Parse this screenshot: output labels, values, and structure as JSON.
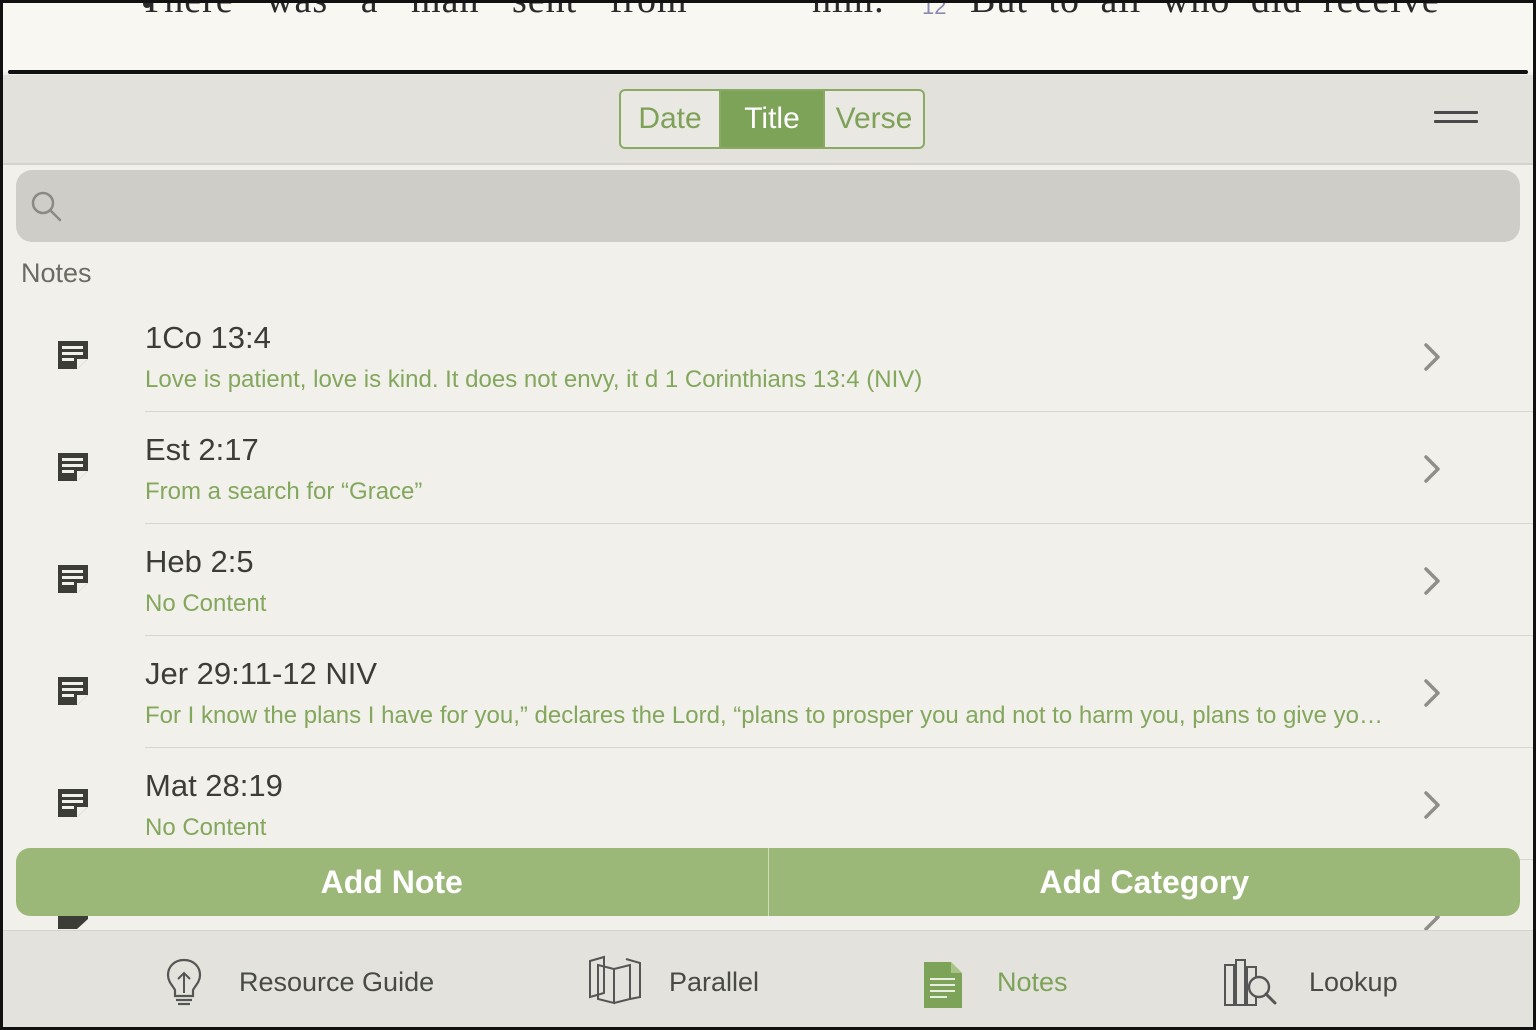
{
  "bible_text": {
    "left_line": "There was a man sent from",
    "right_line_a": "him.",
    "verse_number": "12",
    "right_line_b": "But to all who did receive"
  },
  "header": {
    "sort_options": [
      {
        "label": "Date",
        "selected": false
      },
      {
        "label": "Title",
        "selected": true
      },
      {
        "label": "Verse",
        "selected": false
      }
    ],
    "menu_icon": "hamburger-menu-icon"
  },
  "search": {
    "placeholder": "",
    "value": ""
  },
  "section": {
    "label": "Notes"
  },
  "notes": [
    {
      "title": "1Co 13:4",
      "subtitle": "Love is patient, love is kind. It does not envy, it d 1 Corinthians 13:4 (NIV)"
    },
    {
      "title": "Est 2:17",
      "subtitle": "From a search for “Grace”"
    },
    {
      "title": "Heb 2:5",
      "subtitle": "No Content"
    },
    {
      "title": "Jer 29:11-12 NIV",
      "subtitle": "For I know the plans I have for you,” declares the Lord, “plans to prosper you and not to harm you, plans to give yo…"
    },
    {
      "title": "Mat 28:19",
      "subtitle": "No Content"
    }
  ],
  "actions": {
    "add_note": "Add Note",
    "add_category": "Add Category"
  },
  "tabbar": {
    "tabs": [
      {
        "label": "Resource Guide",
        "icon": "lightbulb-icon",
        "active": false
      },
      {
        "label": "Parallel",
        "icon": "open-book-icon",
        "active": false
      },
      {
        "label": "Notes",
        "icon": "notes-document-icon",
        "active": true
      },
      {
        "label": "Lookup",
        "icon": "books-magnifier-icon",
        "active": false
      }
    ]
  },
  "colors": {
    "accent": "#7da359",
    "accent_light": "#9cb878",
    "subtitle_green": "#83a75d",
    "background": "#f1f0ea",
    "header_bg": "#e2e1db"
  }
}
